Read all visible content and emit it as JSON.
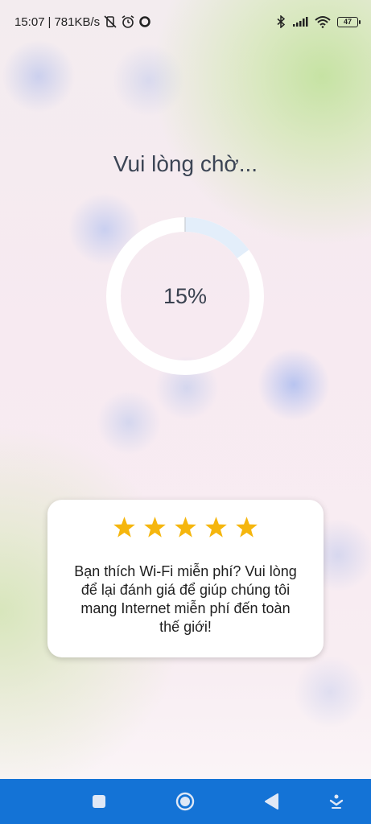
{
  "status_bar": {
    "time": "15:07",
    "separator": "|",
    "network_speed": "781KB/s",
    "battery_level": "47",
    "icons": [
      "mute-vibrate-icon",
      "alarm-icon",
      "circle-notification-icon",
      "bluetooth-icon",
      "signal-icon",
      "wifi-icon",
      "battery-icon"
    ]
  },
  "main": {
    "title": "Vui lòng chờ...",
    "progress_text": "15%",
    "progress_value": 0.15
  },
  "rating_card": {
    "stars": 5,
    "message": "Bạn thích Wi-Fi miễn phí? Vui lòng để lại đánh giá để giúp chúng tôi mang Internet miễn phí đến toàn thế giới!"
  },
  "nav_bar": {
    "buttons": [
      "recents-square-icon",
      "home-circle-icon",
      "back-triangle-icon",
      "assistant-down-icon"
    ]
  },
  "colors": {
    "nav_bar": "#1473d6",
    "star": "#f5b60e",
    "ring_track": "#ffffff",
    "ring_progress": "#e3eefa",
    "text_dark": "#3c4555"
  }
}
